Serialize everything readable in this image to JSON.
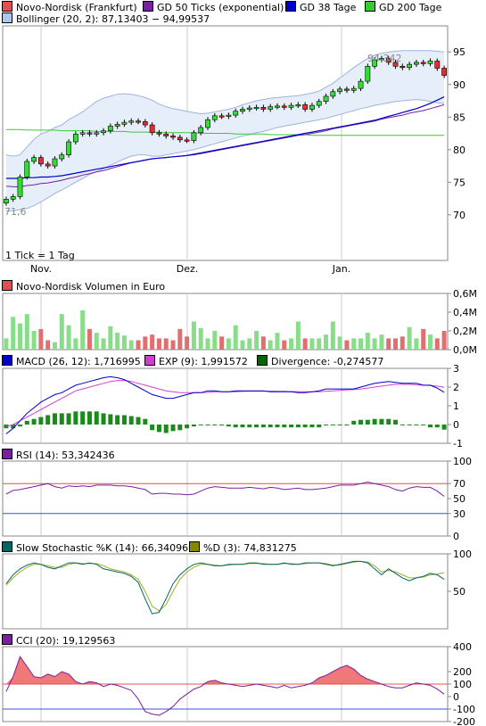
{
  "legend_main": [
    {
      "label": "Novo-Nordisk (Frankfurt)",
      "color": "#e05050"
    },
    {
      "label": "GD 50 Ticks (exponential)",
      "color": "#7a1fa0"
    },
    {
      "label": "GD 38 Tage",
      "color": "#0000c8"
    },
    {
      "label": "GD 200 Tage",
      "color": "#33cc33"
    }
  ],
  "legend_bollinger": {
    "label": "Bollinger (20, 2): 87,13403 − 94,99537",
    "color": "#aec6ee"
  },
  "legend_volume": {
    "label": "Novo-Nordisk Volumen in Euro",
    "color": "#e05050"
  },
  "legend_macd": [
    {
      "label": "MACD (26, 12): 1,716995",
      "color": "#0000c8"
    },
    {
      "label": "EXP (9): 1,991572",
      "color": "#d040d0"
    },
    {
      "label": "Divergence: -0,274577",
      "color": "#006600"
    }
  ],
  "legend_rsi": {
    "label": "RSI (14): 53,342436",
    "color": "#7a1fa0"
  },
  "legend_stoch": [
    {
      "label": "Slow Stochastic %K (14): 66,340969",
      "color": "#006666"
    },
    {
      "label": "%D (3): 74,831275",
      "color": "#888800"
    }
  ],
  "legend_cci": {
    "label": "CCI (20): 19,129563",
    "color": "#7a1fa0"
  },
  "price_high_label": "94,342",
  "price_low_label": "71,6",
  "tick_note": "1 Tick = 1 Tag",
  "x_labels": [
    "Nov.",
    "Dez.",
    "Jan."
  ],
  "chart_data": [
    {
      "type": "candlestick",
      "title": "Novo-Nordisk (Frankfurt)",
      "x_ticks": [
        "Nov.",
        "Dez.",
        "Jan."
      ],
      "y_ticks": [
        70,
        75,
        80,
        85,
        90,
        95
      ],
      "ylim": [
        63,
        99
      ],
      "annotations": {
        "high": 94.342,
        "low": 71.6
      },
      "close": [
        72.4,
        72.8,
        75.8,
        78.2,
        78.8,
        77.8,
        77.5,
        78.6,
        79.2,
        81.2,
        82.4,
        82.6,
        82.4,
        82.6,
        82.9,
        83.6,
        83.9,
        84.2,
        84.4,
        84.3,
        83.8,
        82.6,
        82.4,
        82.1,
        81.9,
        81.5,
        81.4,
        82.6,
        83.4,
        84.6,
        85.2,
        85.1,
        85.3,
        85.9,
        86.2,
        86.4,
        86.5,
        86.2,
        86.6,
        86.7,
        86.5,
        86.8,
        86.9,
        86.2,
        86.8,
        87.4,
        88.2,
        88.9,
        89.3,
        89.1,
        89.4,
        90.5,
        92.8,
        93.8,
        94.0,
        93.4,
        92.8,
        92.6,
        93.1,
        93.4,
        93.2,
        93.6,
        92.5,
        91.4
      ],
      "series": [
        {
          "name": "GD 50 Ticks (exponential)",
          "values": [
            74.4,
            74.3,
            74.3,
            74.5,
            74.6,
            74.8,
            74.9,
            75.1,
            75.3,
            75.6,
            75.8,
            76.1,
            76.3,
            76.6,
            76.8,
            77.1,
            77.4,
            77.7,
            78.0,
            78.2,
            78.4,
            78.6,
            78.7,
            78.8,
            78.9,
            79.0,
            79.1,
            79.2,
            79.4,
            79.6,
            79.8,
            80.0,
            80.2,
            80.4,
            80.6,
            80.8,
            81.0,
            81.2,
            81.4,
            81.6,
            81.8,
            82.0,
            82.2,
            82.3,
            82.5,
            82.7,
            82.9,
            83.2,
            83.4,
            83.6,
            83.8,
            84.0,
            84.2,
            84.4,
            84.7,
            84.9,
            85.1,
            85.3,
            85.6,
            85.8,
            86.0,
            86.3,
            86.6,
            86.9
          ]
        },
        {
          "name": "GD 38 Tage",
          "values": [
            75.6,
            75.6,
            75.6,
            75.7,
            75.7,
            75.8,
            75.8,
            75.9,
            76.0,
            76.2,
            76.4,
            76.6,
            76.8,
            77.0,
            77.2,
            77.4,
            77.6,
            77.8,
            78.0,
            78.2,
            78.4,
            78.6,
            78.7,
            78.8,
            78.9,
            79.0,
            79.1,
            79.3,
            79.5,
            79.7,
            79.9,
            80.1,
            80.3,
            80.5,
            80.7,
            80.9,
            81.1,
            81.3,
            81.5,
            81.7,
            81.9,
            82.1,
            82.3,
            82.5,
            82.7,
            82.9,
            83.1,
            83.3,
            83.5,
            83.7,
            83.9,
            84.1,
            84.3,
            84.5,
            84.8,
            85.1,
            85.4,
            85.7,
            86.0,
            86.3,
            86.7,
            87.1,
            87.6,
            88.1
          ]
        },
        {
          "name": "GD 200 Tage",
          "values": [
            83.1,
            83.1,
            83.1,
            83.0,
            83.0,
            83.0,
            83.0,
            83.0,
            82.9,
            82.9,
            82.9,
            82.9,
            82.9,
            82.8,
            82.8,
            82.8,
            82.8,
            82.8,
            82.7,
            82.7,
            82.7,
            82.7,
            82.7,
            82.6,
            82.6,
            82.6,
            82.6,
            82.6,
            82.5,
            82.5,
            82.5,
            82.5,
            82.5,
            82.4,
            82.4,
            82.4,
            82.4,
            82.4,
            82.3,
            82.3,
            82.3,
            82.3,
            82.3,
            82.3,
            82.2,
            82.2,
            82.2,
            82.2,
            82.2,
            82.2,
            82.2,
            82.2,
            82.2,
            82.2,
            82.2,
            82.2,
            82.2,
            82.2,
            82.2,
            82.2,
            82.2,
            82.2,
            82.2,
            82.2
          ]
        },
        {
          "name": "Bollinger upper",
          "values": [
            79.2,
            79.0,
            79.2,
            80.4,
            81.6,
            82.4,
            82.8,
            83.4,
            83.8,
            84.6,
            85.2,
            85.8,
            86.6,
            87.4,
            87.9,
            88.2,
            88.5,
            88.6,
            88.5,
            88.3,
            88.0,
            87.6,
            87.0,
            86.6,
            86.3,
            86.1,
            85.9,
            85.7,
            85.5,
            85.6,
            85.8,
            86.0,
            86.2,
            86.5,
            86.9,
            87.2,
            87.5,
            87.7,
            87.9,
            88.0,
            88.1,
            88.2,
            88.3,
            88.5,
            88.7,
            89.0,
            89.6,
            90.2,
            91.0,
            91.8,
            92.6,
            93.3,
            94.0,
            94.5,
            94.8,
            95.0,
            95.1,
            95.2,
            95.2,
            95.2,
            95.2,
            95.2,
            95.1,
            95.0
          ]
        },
        {
          "name": "Bollinger lower",
          "values": [
            70.6,
            70.6,
            70.8,
            71.0,
            71.4,
            72.0,
            72.6,
            73.3,
            73.8,
            74.4,
            75.0,
            75.6,
            76.2,
            76.6,
            77.1,
            77.6,
            78.1,
            78.6,
            79.0,
            79.2,
            79.2,
            79.0,
            79.0,
            79.2,
            79.4,
            79.6,
            79.8,
            80.0,
            80.3,
            80.6,
            80.9,
            81.2,
            81.5,
            81.8,
            82.1,
            82.3,
            82.6,
            82.8,
            83.1,
            83.4,
            83.6,
            83.8,
            84.0,
            84.2,
            84.4,
            84.6,
            84.8,
            85.1,
            85.4,
            85.7,
            86.0,
            86.3,
            86.5,
            86.8,
            87.0,
            87.2,
            87.4,
            87.5,
            87.6,
            87.7,
            87.6,
            87.4,
            87.2,
            87.1
          ]
        }
      ]
    },
    {
      "type": "bar",
      "title": "Novo-Nordisk Volumen in Euro",
      "y_ticks": [
        "0,0M",
        "0,2M",
        "0,4M",
        "0,6M"
      ],
      "ylim": [
        0,
        0.6
      ],
      "values": [
        0.12,
        0.35,
        0.28,
        0.38,
        0.2,
        0.22,
        0.1,
        0.08,
        0.38,
        0.26,
        0.12,
        0.42,
        0.22,
        0.18,
        0.12,
        0.25,
        0.18,
        0.15,
        0.1,
        0.1,
        0.14,
        0.16,
        0.12,
        0.12,
        0.1,
        0.22,
        0.14,
        0.3,
        0.23,
        0.12,
        0.2,
        0.14,
        0.12,
        0.26,
        0.1,
        0.12,
        0.2,
        0.14,
        0.1,
        0.18,
        0.1,
        0.12,
        0.3,
        0.12,
        0.12,
        0.12,
        0.16,
        0.3,
        0.14,
        0.1,
        0.12,
        0.12,
        0.18,
        0.12,
        0.16,
        0.12,
        0.12,
        0.14,
        0.24,
        0.12,
        0.22,
        0.16,
        0.12,
        0.2
      ]
    },
    {
      "type": "line",
      "title": "MACD (26, 12)",
      "y_ticks": [
        -1,
        0,
        1,
        2,
        3
      ],
      "ylim": [
        -1,
        3
      ],
      "series": [
        {
          "name": "MACD (26, 12)",
          "values": [
            -0.5,
            -0.2,
            0.2,
            0.6,
            0.9,
            1.2,
            1.4,
            1.6,
            1.7,
            1.9,
            2.1,
            2.2,
            2.3,
            2.4,
            2.5,
            2.55,
            2.5,
            2.4,
            2.2,
            2.0,
            1.8,
            1.6,
            1.5,
            1.4,
            1.4,
            1.5,
            1.6,
            1.7,
            1.7,
            1.8,
            1.8,
            1.75,
            1.75,
            1.8,
            1.8,
            1.8,
            1.8,
            1.8,
            1.75,
            1.75,
            1.75,
            1.75,
            1.7,
            1.7,
            1.75,
            1.8,
            1.9,
            1.9,
            1.9,
            1.9,
            1.9,
            2.0,
            2.1,
            2.2,
            2.25,
            2.3,
            2.25,
            2.2,
            2.2,
            2.2,
            2.1,
            2.1,
            1.95,
            1.72
          ]
        },
        {
          "name": "EXP (9)",
          "values": [
            -0.1,
            0.0,
            0.2,
            0.4,
            0.6,
            0.8,
            1.0,
            1.2,
            1.4,
            1.6,
            1.8,
            1.9,
            2.0,
            2.1,
            2.2,
            2.3,
            2.35,
            2.35,
            2.3,
            2.2,
            2.1,
            2.0,
            1.9,
            1.8,
            1.75,
            1.7,
            1.7,
            1.7,
            1.7,
            1.72,
            1.75,
            1.75,
            1.75,
            1.75,
            1.77,
            1.78,
            1.78,
            1.78,
            1.78,
            1.77,
            1.77,
            1.76,
            1.75,
            1.75,
            1.75,
            1.75,
            1.78,
            1.8,
            1.83,
            1.85,
            1.87,
            1.9,
            1.95,
            2.0,
            2.05,
            2.1,
            2.15,
            2.15,
            2.15,
            2.12,
            2.1,
            2.08,
            2.05,
            1.99
          ]
        },
        {
          "name": "Divergence",
          "values": [
            -0.2,
            -0.2,
            -0.1,
            0.2,
            0.3,
            0.4,
            0.5,
            0.6,
            0.6,
            0.6,
            0.7,
            0.7,
            0.7,
            0.7,
            0.6,
            0.55,
            0.5,
            0.5,
            0.45,
            0.4,
            0.3,
            -0.3,
            -0.4,
            -0.45,
            -0.35,
            -0.3,
            -0.2,
            -0.1,
            0.0,
            0.0,
            0.0,
            0.0,
            -0.1,
            -0.15,
            -0.15,
            -0.15,
            -0.15,
            -0.15,
            -0.15,
            -0.15,
            -0.15,
            -0.15,
            -0.15,
            -0.15,
            -0.15,
            -0.15,
            0.0,
            0.0,
            0.0,
            0.0,
            0.2,
            0.25,
            0.25,
            0.3,
            0.3,
            0.3,
            0.25,
            0.0,
            0.0,
            0.0,
            0.0,
            -0.15,
            -0.15,
            -0.27
          ]
        }
      ]
    },
    {
      "type": "line",
      "title": "RSI (14)",
      "y_ticks": [
        0,
        30,
        50,
        70,
        100
      ],
      "ylim": [
        0,
        100
      ],
      "reference_lines": [
        30,
        70
      ],
      "values": [
        56,
        61,
        62,
        64,
        66,
        68,
        70,
        66,
        64,
        67,
        66,
        67,
        66,
        68,
        68,
        68,
        67,
        67,
        66,
        64,
        62,
        56,
        57,
        57,
        56,
        56,
        55,
        56,
        60,
        64,
        66,
        65,
        64,
        64,
        64,
        65,
        64,
        63,
        65,
        64,
        62,
        63,
        64,
        62,
        62,
        63,
        64,
        66,
        68,
        68,
        68,
        70,
        72,
        70,
        68,
        66,
        62,
        60,
        64,
        66,
        65,
        65,
        60,
        53
      ]
    },
    {
      "type": "line",
      "title": "Slow Stochastic %K (14)",
      "y_ticks": [
        50,
        100
      ],
      "ylim": [
        0,
        100
      ],
      "series": [
        {
          "name": "Slow Stochastic %K (14)",
          "values": [
            60,
            72,
            80,
            85,
            88,
            86,
            82,
            80,
            84,
            88,
            88,
            86,
            88,
            86,
            80,
            78,
            76,
            74,
            70,
            62,
            40,
            20,
            22,
            40,
            60,
            72,
            80,
            86,
            88,
            86,
            84,
            84,
            86,
            86,
            86,
            88,
            88,
            86,
            86,
            86,
            88,
            86,
            86,
            88,
            88,
            88,
            86,
            84,
            86,
            88,
            90,
            90,
            88,
            80,
            72,
            80,
            74,
            68,
            64,
            68,
            70,
            74,
            72,
            66
          ]
        },
        {
          "name": "%D (3)",
          "values": [
            58,
            68,
            76,
            82,
            86,
            86,
            84,
            82,
            82,
            86,
            88,
            87,
            87,
            87,
            84,
            80,
            78,
            76,
            72,
            66,
            50,
            30,
            24,
            32,
            50,
            66,
            76,
            82,
            86,
            86,
            85,
            84,
            85,
            86,
            86,
            87,
            87,
            87,
            86,
            86,
            87,
            87,
            86,
            87,
            88,
            88,
            87,
            85,
            85,
            87,
            89,
            90,
            89,
            84,
            76,
            78,
            76,
            72,
            68,
            68,
            69,
            72,
            73,
            75
          ]
        }
      ]
    },
    {
      "type": "line",
      "title": "CCI (20)",
      "y_ticks": [
        -200,
        -100,
        0,
        100,
        200,
        400
      ],
      "ylim": [
        -200,
        400
      ],
      "reference_lines": [
        -100,
        100
      ],
      "values": [
        40,
        160,
        320,
        240,
        160,
        150,
        180,
        160,
        200,
        180,
        120,
        100,
        120,
        110,
        80,
        100,
        90,
        70,
        50,
        -20,
        -120,
        -140,
        -150,
        -120,
        -80,
        -20,
        20,
        60,
        80,
        120,
        130,
        110,
        100,
        90,
        80,
        90,
        100,
        90,
        80,
        70,
        90,
        70,
        80,
        90,
        110,
        150,
        170,
        200,
        230,
        250,
        220,
        170,
        140,
        120,
        100,
        80,
        70,
        70,
        90,
        110,
        100,
        90,
        60,
        20
      ]
    }
  ]
}
